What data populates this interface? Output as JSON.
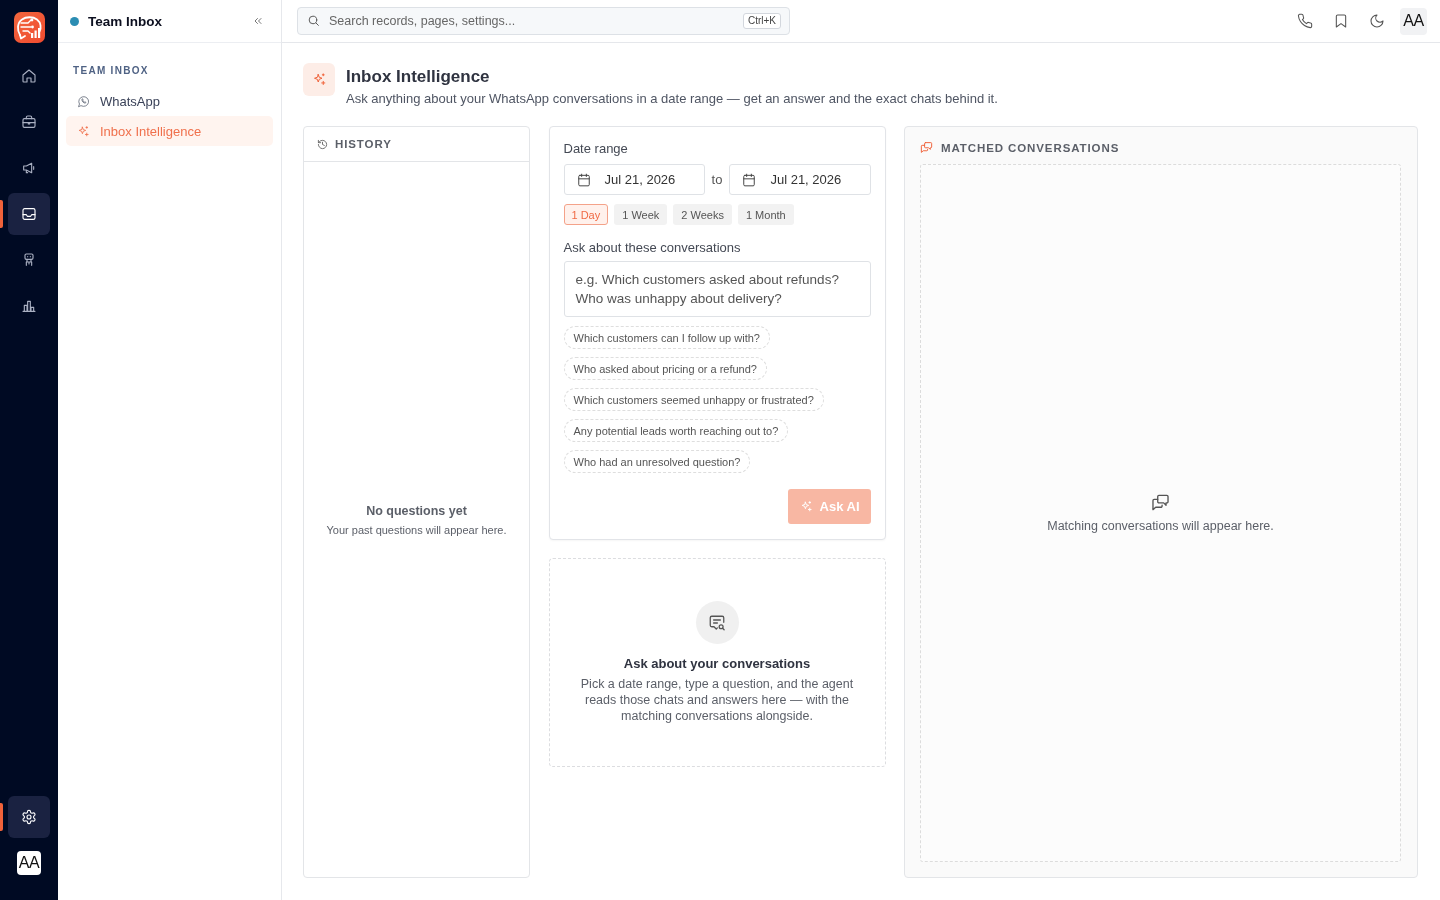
{
  "rail": {
    "items": [
      {
        "selected": false
      },
      {
        "selected": false
      },
      {
        "selected": false
      },
      {
        "selected": true
      },
      {
        "selected": false
      },
      {
        "selected": false
      }
    ],
    "bottom_items": [
      {
        "selected": true
      }
    ],
    "avatar": "AA"
  },
  "sidebar": {
    "title": "Team Inbox",
    "section_label": "TEAM INBOX",
    "items": [
      {
        "label": "WhatsApp",
        "selected": false
      },
      {
        "label": "Inbox Intelligence",
        "selected": true
      }
    ]
  },
  "topbar": {
    "search": {
      "placeholder": "Search records, pages, settings...",
      "shortcut": "Ctrl+K"
    },
    "avatar": "AA"
  },
  "page": {
    "title": "Inbox Intelligence",
    "subtitle": "Ask anything about your WhatsApp conversations in a date range — get an answer and the exact chats behind it."
  },
  "history": {
    "title": "HISTORY",
    "empty_title": "No questions yet",
    "empty_text": "Your past questions will appear here."
  },
  "query": {
    "date_label": "Date range",
    "from": "Jul 21, 2026",
    "separator": "to",
    "to": "Jul 21, 2026",
    "presets": [
      {
        "label": "1 Day",
        "selected": true
      },
      {
        "label": "1 Week",
        "selected": false
      },
      {
        "label": "2 Weeks",
        "selected": false
      },
      {
        "label": "1 Month",
        "selected": false
      }
    ],
    "question_label": "Ask about these conversations",
    "question": {
      "placeholder": "e.g. Which customers asked about refunds? Who was unhappy about delivery?"
    },
    "suggestions": [
      "Which customers can I follow up with?",
      "Who asked about pricing or a refund?",
      "Which customers seemed unhappy or frustrated?",
      "Any potential leads worth reaching out to?",
      "Who had an unresolved question?"
    ],
    "ask_button": {
      "label": "Ask AI",
      "disabled": true
    }
  },
  "intro": {
    "title": "Ask about your conversations",
    "text": "Pick a date range, type a question, and the agent reads those chats and answers here — with the matching conversations alongside."
  },
  "matched": {
    "title": "MATCHED CONVERSATIONS",
    "empty_text": "Matching conversations will appear here."
  }
}
